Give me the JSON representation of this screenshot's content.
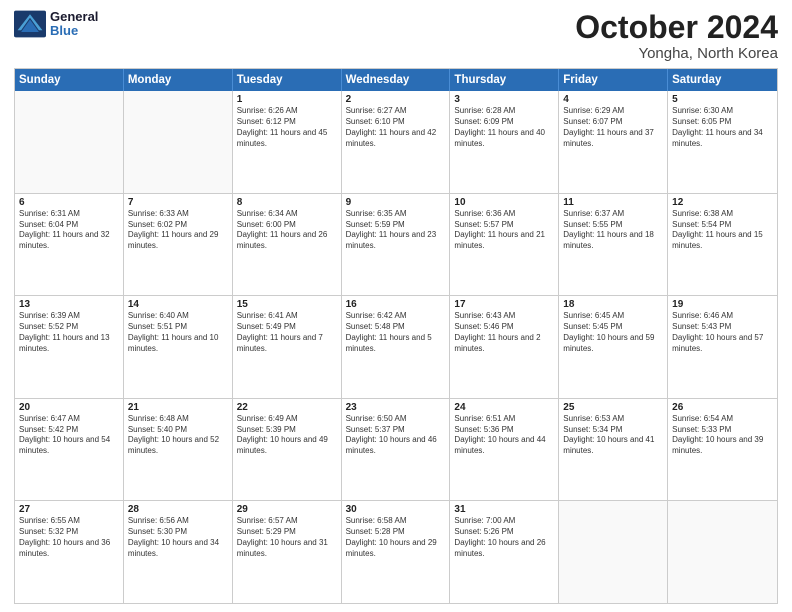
{
  "header": {
    "logo_general": "General",
    "logo_blue": "Blue",
    "month": "October 2024",
    "location": "Yongha, North Korea"
  },
  "days_of_week": [
    "Sunday",
    "Monday",
    "Tuesday",
    "Wednesday",
    "Thursday",
    "Friday",
    "Saturday"
  ],
  "weeks": [
    [
      {
        "day": "",
        "sunrise": "",
        "sunset": "",
        "daylight": "",
        "empty": true
      },
      {
        "day": "",
        "sunrise": "",
        "sunset": "",
        "daylight": "",
        "empty": true
      },
      {
        "day": "1",
        "sunrise": "Sunrise: 6:26 AM",
        "sunset": "Sunset: 6:12 PM",
        "daylight": "Daylight: 11 hours and 45 minutes."
      },
      {
        "day": "2",
        "sunrise": "Sunrise: 6:27 AM",
        "sunset": "Sunset: 6:10 PM",
        "daylight": "Daylight: 11 hours and 42 minutes."
      },
      {
        "day": "3",
        "sunrise": "Sunrise: 6:28 AM",
        "sunset": "Sunset: 6:09 PM",
        "daylight": "Daylight: 11 hours and 40 minutes."
      },
      {
        "day": "4",
        "sunrise": "Sunrise: 6:29 AM",
        "sunset": "Sunset: 6:07 PM",
        "daylight": "Daylight: 11 hours and 37 minutes."
      },
      {
        "day": "5",
        "sunrise": "Sunrise: 6:30 AM",
        "sunset": "Sunset: 6:05 PM",
        "daylight": "Daylight: 11 hours and 34 minutes."
      }
    ],
    [
      {
        "day": "6",
        "sunrise": "Sunrise: 6:31 AM",
        "sunset": "Sunset: 6:04 PM",
        "daylight": "Daylight: 11 hours and 32 minutes."
      },
      {
        "day": "7",
        "sunrise": "Sunrise: 6:33 AM",
        "sunset": "Sunset: 6:02 PM",
        "daylight": "Daylight: 11 hours and 29 minutes."
      },
      {
        "day": "8",
        "sunrise": "Sunrise: 6:34 AM",
        "sunset": "Sunset: 6:00 PM",
        "daylight": "Daylight: 11 hours and 26 minutes."
      },
      {
        "day": "9",
        "sunrise": "Sunrise: 6:35 AM",
        "sunset": "Sunset: 5:59 PM",
        "daylight": "Daylight: 11 hours and 23 minutes."
      },
      {
        "day": "10",
        "sunrise": "Sunrise: 6:36 AM",
        "sunset": "Sunset: 5:57 PM",
        "daylight": "Daylight: 11 hours and 21 minutes."
      },
      {
        "day": "11",
        "sunrise": "Sunrise: 6:37 AM",
        "sunset": "Sunset: 5:55 PM",
        "daylight": "Daylight: 11 hours and 18 minutes."
      },
      {
        "day": "12",
        "sunrise": "Sunrise: 6:38 AM",
        "sunset": "Sunset: 5:54 PM",
        "daylight": "Daylight: 11 hours and 15 minutes."
      }
    ],
    [
      {
        "day": "13",
        "sunrise": "Sunrise: 6:39 AM",
        "sunset": "Sunset: 5:52 PM",
        "daylight": "Daylight: 11 hours and 13 minutes."
      },
      {
        "day": "14",
        "sunrise": "Sunrise: 6:40 AM",
        "sunset": "Sunset: 5:51 PM",
        "daylight": "Daylight: 11 hours and 10 minutes."
      },
      {
        "day": "15",
        "sunrise": "Sunrise: 6:41 AM",
        "sunset": "Sunset: 5:49 PM",
        "daylight": "Daylight: 11 hours and 7 minutes."
      },
      {
        "day": "16",
        "sunrise": "Sunrise: 6:42 AM",
        "sunset": "Sunset: 5:48 PM",
        "daylight": "Daylight: 11 hours and 5 minutes."
      },
      {
        "day": "17",
        "sunrise": "Sunrise: 6:43 AM",
        "sunset": "Sunset: 5:46 PM",
        "daylight": "Daylight: 11 hours and 2 minutes."
      },
      {
        "day": "18",
        "sunrise": "Sunrise: 6:45 AM",
        "sunset": "Sunset: 5:45 PM",
        "daylight": "Daylight: 10 hours and 59 minutes."
      },
      {
        "day": "19",
        "sunrise": "Sunrise: 6:46 AM",
        "sunset": "Sunset: 5:43 PM",
        "daylight": "Daylight: 10 hours and 57 minutes."
      }
    ],
    [
      {
        "day": "20",
        "sunrise": "Sunrise: 6:47 AM",
        "sunset": "Sunset: 5:42 PM",
        "daylight": "Daylight: 10 hours and 54 minutes."
      },
      {
        "day": "21",
        "sunrise": "Sunrise: 6:48 AM",
        "sunset": "Sunset: 5:40 PM",
        "daylight": "Daylight: 10 hours and 52 minutes."
      },
      {
        "day": "22",
        "sunrise": "Sunrise: 6:49 AM",
        "sunset": "Sunset: 5:39 PM",
        "daylight": "Daylight: 10 hours and 49 minutes."
      },
      {
        "day": "23",
        "sunrise": "Sunrise: 6:50 AM",
        "sunset": "Sunset: 5:37 PM",
        "daylight": "Daylight: 10 hours and 46 minutes."
      },
      {
        "day": "24",
        "sunrise": "Sunrise: 6:51 AM",
        "sunset": "Sunset: 5:36 PM",
        "daylight": "Daylight: 10 hours and 44 minutes."
      },
      {
        "day": "25",
        "sunrise": "Sunrise: 6:53 AM",
        "sunset": "Sunset: 5:34 PM",
        "daylight": "Daylight: 10 hours and 41 minutes."
      },
      {
        "day": "26",
        "sunrise": "Sunrise: 6:54 AM",
        "sunset": "Sunset: 5:33 PM",
        "daylight": "Daylight: 10 hours and 39 minutes."
      }
    ],
    [
      {
        "day": "27",
        "sunrise": "Sunrise: 6:55 AM",
        "sunset": "Sunset: 5:32 PM",
        "daylight": "Daylight: 10 hours and 36 minutes."
      },
      {
        "day": "28",
        "sunrise": "Sunrise: 6:56 AM",
        "sunset": "Sunset: 5:30 PM",
        "daylight": "Daylight: 10 hours and 34 minutes."
      },
      {
        "day": "29",
        "sunrise": "Sunrise: 6:57 AM",
        "sunset": "Sunset: 5:29 PM",
        "daylight": "Daylight: 10 hours and 31 minutes."
      },
      {
        "day": "30",
        "sunrise": "Sunrise: 6:58 AM",
        "sunset": "Sunset: 5:28 PM",
        "daylight": "Daylight: 10 hours and 29 minutes."
      },
      {
        "day": "31",
        "sunrise": "Sunrise: 7:00 AM",
        "sunset": "Sunset: 5:26 PM",
        "daylight": "Daylight: 10 hours and 26 minutes."
      },
      {
        "day": "",
        "sunrise": "",
        "sunset": "",
        "daylight": "",
        "empty": true
      },
      {
        "day": "",
        "sunrise": "",
        "sunset": "",
        "daylight": "",
        "empty": true
      }
    ]
  ]
}
